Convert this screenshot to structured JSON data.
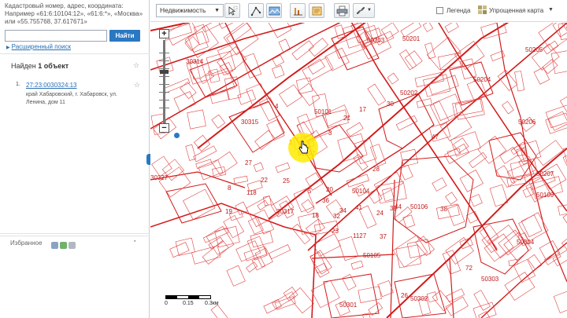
{
  "search": {
    "hint": "Кадастровый номер, адрес, координата: Например «61:6:10104:12», «61:6:*», «Москва» или «55.755768, 37.617671»",
    "input_value": "",
    "button_label": "Найти",
    "advanced_label": "Расширенный поиск"
  },
  "results": {
    "found_prefix": "Найден",
    "found_count": "1 объект",
    "items": [
      {
        "number": "1.",
        "cadastral_number": "27:23:0030324:13",
        "address": "край Хабаровский, г. Хабаровск, ул. Ленина, дом 11"
      }
    ]
  },
  "favorites": {
    "label": "Избранное"
  },
  "toolbar": {
    "layer_select": "Недвижимость",
    "legend_label": "Легенда",
    "mode_label": "Упрощенная карта",
    "tools": [
      "select-tool",
      "measure-tool",
      "map-view-tool",
      "chart-tool",
      "report-tool",
      "print-tool",
      "link-tool"
    ]
  },
  "map": {
    "scale_labels": [
      "0",
      "0.15",
      "0.3км"
    ],
    "parcel_labels": [
      "50201",
      "50202",
      "50101",
      "50203",
      "30314",
      "50206",
      "30315",
      "50107",
      "50204",
      "50205",
      "50207",
      "50104",
      "50106",
      "50105",
      "30317",
      "50304",
      "50303",
      "50301",
      "50302",
      "30327",
      "50109",
      "1",
      "3",
      "4",
      "5",
      "8",
      "17",
      "18",
      "19",
      "20",
      "21",
      "22",
      "23",
      "24",
      "25",
      "26",
      "27",
      "28",
      "32",
      "34",
      "36",
      "37",
      "38",
      "39",
      "41",
      "44",
      "47",
      "1127",
      "118",
      "30",
      "72"
    ],
    "accent_color": "#d21a1a",
    "highlight_color": "#ffeb00"
  }
}
